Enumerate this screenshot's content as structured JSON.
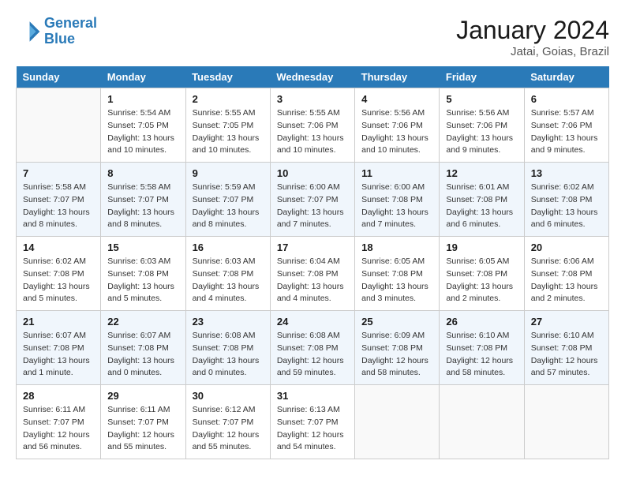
{
  "header": {
    "logo_line1": "General",
    "logo_line2": "Blue",
    "month": "January 2024",
    "location": "Jatai, Goias, Brazil"
  },
  "days_of_week": [
    "Sunday",
    "Monday",
    "Tuesday",
    "Wednesday",
    "Thursday",
    "Friday",
    "Saturday"
  ],
  "weeks": [
    [
      {
        "day": "",
        "info": ""
      },
      {
        "day": "1",
        "info": "Sunrise: 5:54 AM\nSunset: 7:05 PM\nDaylight: 13 hours\nand 10 minutes."
      },
      {
        "day": "2",
        "info": "Sunrise: 5:55 AM\nSunset: 7:05 PM\nDaylight: 13 hours\nand 10 minutes."
      },
      {
        "day": "3",
        "info": "Sunrise: 5:55 AM\nSunset: 7:06 PM\nDaylight: 13 hours\nand 10 minutes."
      },
      {
        "day": "4",
        "info": "Sunrise: 5:56 AM\nSunset: 7:06 PM\nDaylight: 13 hours\nand 10 minutes."
      },
      {
        "day": "5",
        "info": "Sunrise: 5:56 AM\nSunset: 7:06 PM\nDaylight: 13 hours\nand 9 minutes."
      },
      {
        "day": "6",
        "info": "Sunrise: 5:57 AM\nSunset: 7:06 PM\nDaylight: 13 hours\nand 9 minutes."
      }
    ],
    [
      {
        "day": "7",
        "info": "Sunrise: 5:58 AM\nSunset: 7:07 PM\nDaylight: 13 hours\nand 8 minutes."
      },
      {
        "day": "8",
        "info": "Sunrise: 5:58 AM\nSunset: 7:07 PM\nDaylight: 13 hours\nand 8 minutes."
      },
      {
        "day": "9",
        "info": "Sunrise: 5:59 AM\nSunset: 7:07 PM\nDaylight: 13 hours\nand 8 minutes."
      },
      {
        "day": "10",
        "info": "Sunrise: 6:00 AM\nSunset: 7:07 PM\nDaylight: 13 hours\nand 7 minutes."
      },
      {
        "day": "11",
        "info": "Sunrise: 6:00 AM\nSunset: 7:08 PM\nDaylight: 13 hours\nand 7 minutes."
      },
      {
        "day": "12",
        "info": "Sunrise: 6:01 AM\nSunset: 7:08 PM\nDaylight: 13 hours\nand 6 minutes."
      },
      {
        "day": "13",
        "info": "Sunrise: 6:02 AM\nSunset: 7:08 PM\nDaylight: 13 hours\nand 6 minutes."
      }
    ],
    [
      {
        "day": "14",
        "info": "Sunrise: 6:02 AM\nSunset: 7:08 PM\nDaylight: 13 hours\nand 5 minutes."
      },
      {
        "day": "15",
        "info": "Sunrise: 6:03 AM\nSunset: 7:08 PM\nDaylight: 13 hours\nand 5 minutes."
      },
      {
        "day": "16",
        "info": "Sunrise: 6:03 AM\nSunset: 7:08 PM\nDaylight: 13 hours\nand 4 minutes."
      },
      {
        "day": "17",
        "info": "Sunrise: 6:04 AM\nSunset: 7:08 PM\nDaylight: 13 hours\nand 4 minutes."
      },
      {
        "day": "18",
        "info": "Sunrise: 6:05 AM\nSunset: 7:08 PM\nDaylight: 13 hours\nand 3 minutes."
      },
      {
        "day": "19",
        "info": "Sunrise: 6:05 AM\nSunset: 7:08 PM\nDaylight: 13 hours\nand 2 minutes."
      },
      {
        "day": "20",
        "info": "Sunrise: 6:06 AM\nSunset: 7:08 PM\nDaylight: 13 hours\nand 2 minutes."
      }
    ],
    [
      {
        "day": "21",
        "info": "Sunrise: 6:07 AM\nSunset: 7:08 PM\nDaylight: 13 hours\nand 1 minute."
      },
      {
        "day": "22",
        "info": "Sunrise: 6:07 AM\nSunset: 7:08 PM\nDaylight: 13 hours\nand 0 minutes."
      },
      {
        "day": "23",
        "info": "Sunrise: 6:08 AM\nSunset: 7:08 PM\nDaylight: 13 hours\nand 0 minutes."
      },
      {
        "day": "24",
        "info": "Sunrise: 6:08 AM\nSunset: 7:08 PM\nDaylight: 12 hours\nand 59 minutes."
      },
      {
        "day": "25",
        "info": "Sunrise: 6:09 AM\nSunset: 7:08 PM\nDaylight: 12 hours\nand 58 minutes."
      },
      {
        "day": "26",
        "info": "Sunrise: 6:10 AM\nSunset: 7:08 PM\nDaylight: 12 hours\nand 58 minutes."
      },
      {
        "day": "27",
        "info": "Sunrise: 6:10 AM\nSunset: 7:08 PM\nDaylight: 12 hours\nand 57 minutes."
      }
    ],
    [
      {
        "day": "28",
        "info": "Sunrise: 6:11 AM\nSunset: 7:07 PM\nDaylight: 12 hours\nand 56 minutes."
      },
      {
        "day": "29",
        "info": "Sunrise: 6:11 AM\nSunset: 7:07 PM\nDaylight: 12 hours\nand 55 minutes."
      },
      {
        "day": "30",
        "info": "Sunrise: 6:12 AM\nSunset: 7:07 PM\nDaylight: 12 hours\nand 55 minutes."
      },
      {
        "day": "31",
        "info": "Sunrise: 6:13 AM\nSunset: 7:07 PM\nDaylight: 12 hours\nand 54 minutes."
      },
      {
        "day": "",
        "info": ""
      },
      {
        "day": "",
        "info": ""
      },
      {
        "day": "",
        "info": ""
      }
    ]
  ]
}
